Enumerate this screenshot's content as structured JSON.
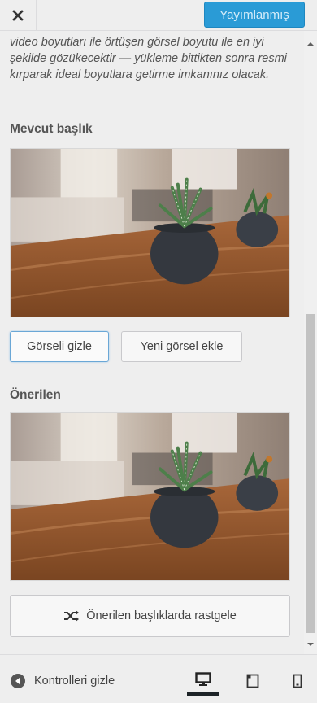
{
  "header": {
    "close_icon": "close-icon",
    "publish_label": "Yayımlanmış"
  },
  "intro_text": "video boyutları ile örtüşen görsel boyutu ile en iyi şekilde gözükecektir — yükleme bittikten sonra resmi kırparak ideal boyutlara getirme imkanınız olacak.",
  "current": {
    "title": "Mevcut başlık",
    "hide_button": "Görseli gizle",
    "add_button": "Yeni görsel ekle"
  },
  "suggested": {
    "title": "Önerilen",
    "randomize_button": "Önerilen başlıklarda rastgele",
    "randomize_icon": "shuffle-icon"
  },
  "footer": {
    "collapse_label": "Kontrolleri gizle",
    "collapse_icon": "arrow-left-circle-icon",
    "devices": [
      "desktop-icon",
      "tablet-icon",
      "mobile-icon"
    ]
  },
  "colors": {
    "publish_bg": "#2a9bd6",
    "focus_border": "#6aa7d6"
  }
}
